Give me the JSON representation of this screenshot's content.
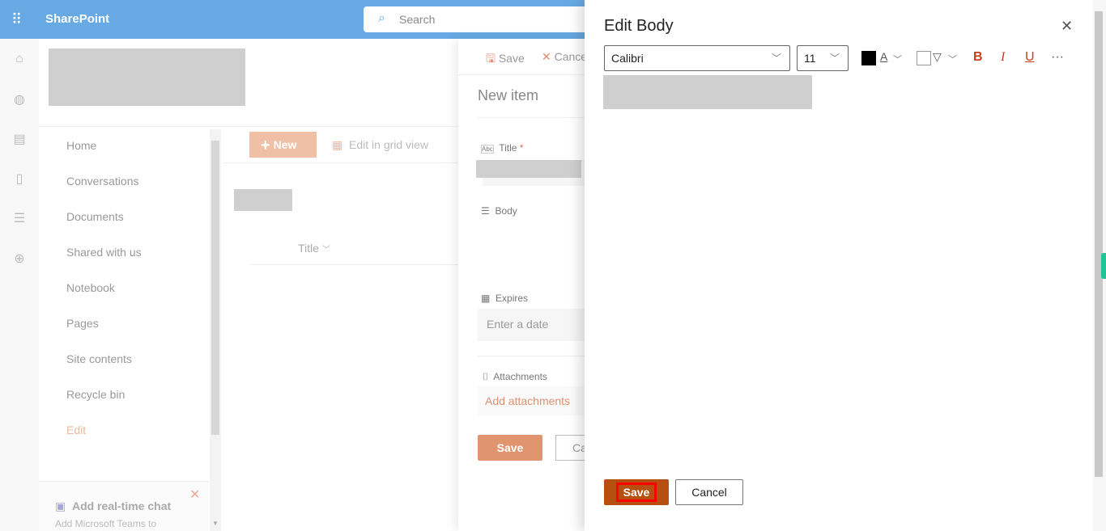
{
  "topbar": {
    "app_name": "SharePoint",
    "search_placeholder": "Search",
    "waffle_icon": "waffle-icon"
  },
  "rail": {
    "icons": [
      "home-icon",
      "globe-icon",
      "news-icon",
      "file-icon",
      "list-icon",
      "add-circle-icon"
    ]
  },
  "nav": {
    "items": [
      "Home",
      "Conversations",
      "Documents",
      "Shared with us",
      "Notebook",
      "Pages",
      "Site contents",
      "Recycle bin",
      "Edit"
    ]
  },
  "chat_card": {
    "title": "Add real-time chat",
    "text": "Add Microsoft Teams to"
  },
  "commandbar": {
    "new_label": "New",
    "grid_label": "Edit in grid view"
  },
  "list": {
    "column_title": "Title"
  },
  "panel": {
    "save_label": "Save",
    "cancel_label": "Cancel",
    "heading": "New item",
    "fields": {
      "title_label": "Title",
      "required_mark": "*",
      "body_label": "Body",
      "expires_label": "Expires",
      "expires_placeholder": "Enter a date",
      "attachments_label": "Attachments",
      "add_attachments": "Add attachments"
    },
    "save_button": "Save",
    "cancel_button": "Cancel"
  },
  "dialog": {
    "title": "Edit Body",
    "font": "Calibri",
    "size": "11",
    "font_color": "#000000",
    "bold": "B",
    "italic": "I",
    "underline": "U",
    "font_color_glyph": "A",
    "more": "···",
    "save": "Save",
    "cancel": "Cancel"
  },
  "colors": {
    "accent": "#ca5010",
    "topbar": "#67a9e3",
    "save_dialog": "#b74f10",
    "highlight": "#ff0000"
  }
}
